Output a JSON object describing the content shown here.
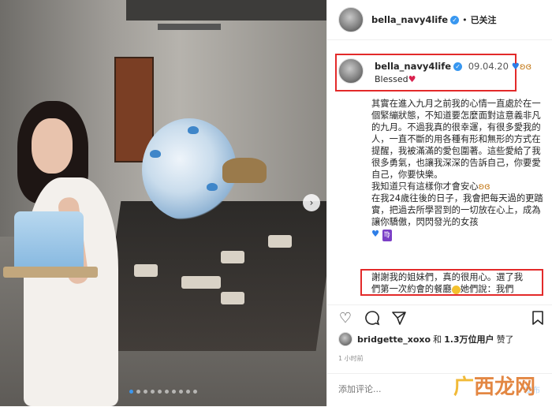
{
  "header": {
    "username": "bella_navy4life",
    "verified_icon": "verified-check-icon",
    "separator": "•",
    "follow_status": "已关注"
  },
  "caption_head": {
    "username": "bella_navy4life",
    "date": "09.04.20",
    "line2": "Blessed"
  },
  "caption_body": [
    "其實在進入九月之前我的心情一直處於在一個緊繃狀態，不知道要怎麼面對這意義非凡的九月。不過我真的很幸運，有很多愛我的人，一直不斷的用各種有形和無形的方式在提醒，我被滿滿的愛包圍著。這些愛給了我很多勇氣，也讓我深深的告訴自己，你要愛自己，你要快樂。",
    "我知道只有這樣你才會安心",
    "在我24歲往後的日子，我會把每天過的更踏實，把過去所學習到的一切放在心上，成為讓你驕傲，閃閃發光的女孩"
  ],
  "caption_bottom": {
    "line1": "謝謝我的姐妹們，真的很用心。選了我",
    "line2_a": "們第一次約會的餐廳",
    "line2_b": "她們說：我們"
  },
  "likes": {
    "liker": "bridgette_xoxo",
    "and": "和",
    "count": "1.3万",
    "others": "位用户",
    "suffix": "赞了"
  },
  "time_ago": "1 小时前",
  "comment": {
    "placeholder": "添加评论...",
    "post_label": "发布"
  },
  "watermark": {
    "logo": "广",
    "text": "西龙网"
  },
  "carousel": {
    "slide_count": 10,
    "active_index": 0
  },
  "colors": {
    "accent_blue": "#3897f0",
    "highlight_red": "#e32a2a",
    "watermark_orange": "#e07b2f"
  }
}
